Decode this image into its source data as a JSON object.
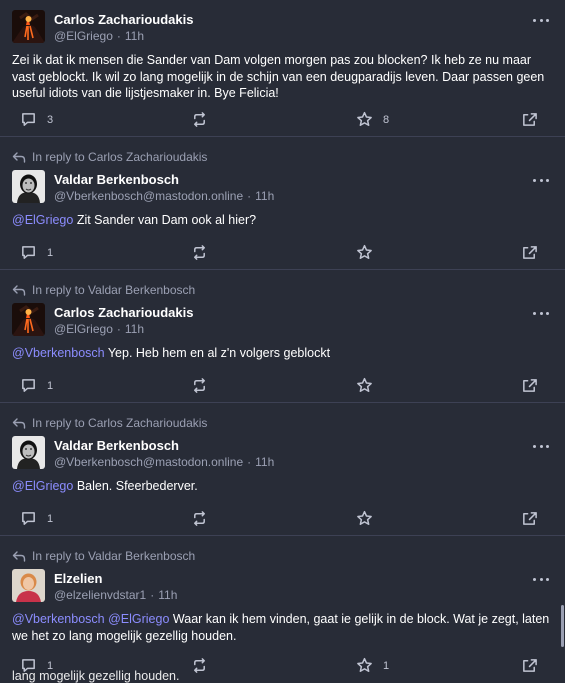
{
  "posts": [
    {
      "reply_to": "",
      "author": "Carlos Zacharioudakis",
      "handle": "@ElGriego",
      "time": "11h",
      "mentions": [],
      "text": "Zei ik dat ik mensen die Sander van Dam volgen morgen pas zou blocken? Ik heb ze nu maar vast geblockt. Ik wil zo lang mogelijk in de schijn van een deugparadijs leven. Daar passen geen useful idiots van die lijstjesmaker in. Bye Felicia!",
      "replies": "3",
      "boosts": "",
      "favourites": "8"
    },
    {
      "reply_to": "In reply to Carlos Zacharioudakis",
      "author": "Valdar Berkenbosch",
      "handle": "@Vberkenbosch@mastodon.online",
      "time": "11h",
      "mentions": [
        "@ElGriego"
      ],
      "text": "Zit Sander van Dam ook al hier?",
      "replies": "1",
      "boosts": "",
      "favourites": ""
    },
    {
      "reply_to": "In reply to Valdar Berkenbosch",
      "author": "Carlos Zacharioudakis",
      "handle": "@ElGriego",
      "time": "11h",
      "mentions": [
        "@Vberkenbosch"
      ],
      "text": "Yep. Heb hem en al z'n volgers geblockt",
      "replies": "1",
      "boosts": "",
      "favourites": ""
    },
    {
      "reply_to": "In reply to Carlos Zacharioudakis",
      "author": "Valdar Berkenbosch",
      "handle": "@Vberkenbosch@mastodon.online",
      "time": "11h",
      "mentions": [
        "@ElGriego"
      ],
      "text": "Balen. Sfeerbederver.",
      "replies": "1",
      "boosts": "",
      "favourites": ""
    },
    {
      "reply_to": "In reply to Valdar Berkenbosch",
      "author": "Elzelien",
      "handle": "@elzelienvdstar1",
      "time": "11h",
      "mentions": [
        "@Vberkenbosch",
        "@ElGriego"
      ],
      "text": "Waar kan ik hem vinden, gaat ie gelijk in de block. Wat je zegt, laten we het zo lang mogelijk gezellig houden.",
      "replies": "1",
      "boosts": "",
      "favourites": "1"
    }
  ],
  "ghost_text": "lang mogelijk gezellig houden.",
  "separator": "·",
  "colors": {
    "background": "#282c37",
    "mention": "#8c8dff",
    "muted": "#9ba0b3",
    "divider": "#3d4154"
  },
  "icons": {
    "reply_arrow": "reply-arrow-icon",
    "more": "more-icon",
    "reply": "reply-icon",
    "boost": "boost-icon",
    "favourite": "star-icon",
    "share": "share-icon"
  }
}
